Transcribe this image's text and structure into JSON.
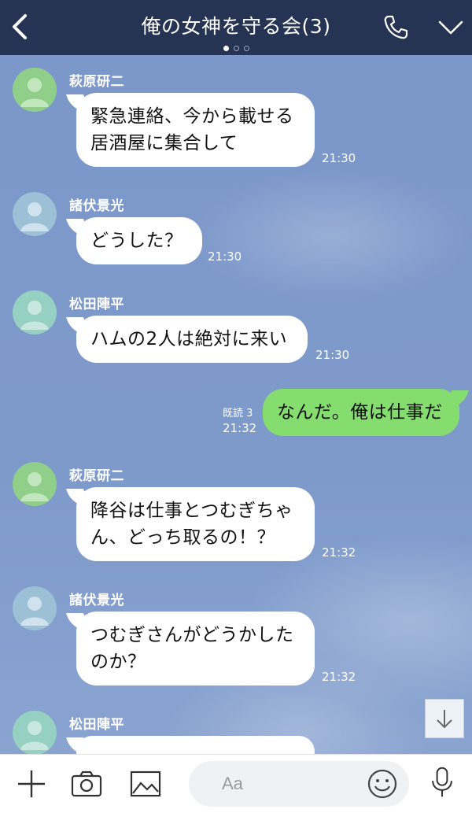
{
  "header": {
    "title": "俺の女神を守る会(3)",
    "page_dots": 3,
    "active_dot": 0
  },
  "messages": [
    {
      "sender": "萩原研二",
      "lines": [
        "緊急連絡、今から載せる",
        "居酒屋に集合して"
      ],
      "time": "21:30"
    },
    {
      "sender": "諸伏景光",
      "lines": [
        "どうした？"
      ],
      "time": "21:30"
    },
    {
      "sender": "松田陣平",
      "lines": [
        "ハムの2人は絶対に来い"
      ],
      "time": "21:30"
    },
    {
      "sent": true,
      "lines": [
        "なんだ。俺は仕事だ"
      ],
      "read": "既読 3",
      "time": "21:32"
    },
    {
      "sender": "萩原研二",
      "lines": [
        "降谷は仕事とつむぎちゃ",
        "ん、どっち取るの！？"
      ],
      "time": "21:32"
    },
    {
      "sender": "諸伏景光",
      "lines": [
        "つむぎさんがどうかした",
        "のか？"
      ],
      "time": "21:32"
    },
    {
      "sender": "松田陣平",
      "lines": [],
      "time": ""
    }
  ],
  "input": {
    "placeholder": "Aa"
  },
  "icons": {
    "back": "back-chevron-icon",
    "call": "phone-icon",
    "menu": "chevron-down-icon",
    "add": "plus-icon",
    "camera": "camera-icon",
    "image": "image-icon",
    "emoji": "smiley-icon",
    "mic": "microphone-icon",
    "scroll": "arrow-down-icon"
  },
  "colors": {
    "header_bg": "#263352",
    "chat_bg": "#7e9acb",
    "sent_bubble": "#85dd6f",
    "received_bubble": "#ffffff"
  }
}
